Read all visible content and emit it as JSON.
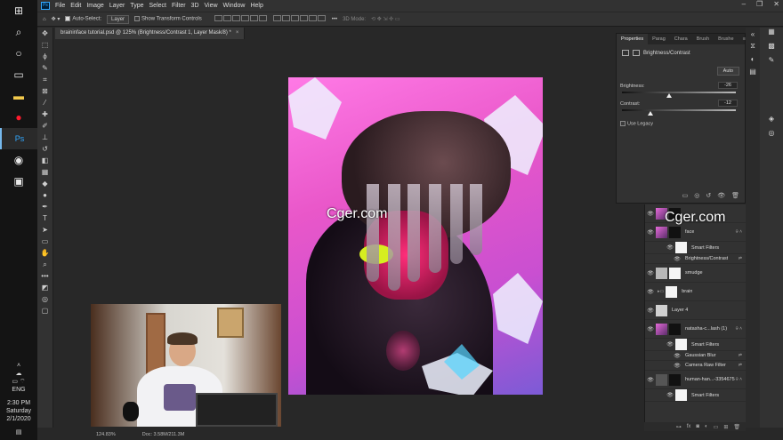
{
  "taskbar": {
    "time": "2:30 PM",
    "day": "Saturday",
    "date": "2/1/2020",
    "lang": "ENG"
  },
  "menu": {
    "items": [
      "File",
      "Edit",
      "Image",
      "Layer",
      "Type",
      "Select",
      "Filter",
      "3D",
      "View",
      "Window",
      "Help"
    ]
  },
  "options": {
    "auto_select_label": "Auto-Select:",
    "auto_select_value": "Layer",
    "show_transform_label": "Show Transform Controls",
    "mode_3d": "3D Mode:"
  },
  "document": {
    "tab_title": "braininface tutorial.psd @ 125% (Brightness/Contrast 1, Layer Mask/8) *",
    "zoom": "124.83%",
    "doc_size": "Doc: 3.58M/211.3M"
  },
  "properties": {
    "tabs": [
      "Properties",
      "Parag",
      "Chara",
      "Brush",
      "Brushe"
    ],
    "adjustment_name": "Brightness/Contrast",
    "auto_label": "Auto",
    "brightness_label": "Brightness:",
    "brightness_value": "-26",
    "brightness_level": -26,
    "contrast_label": "Contrast:",
    "contrast_value": "-12",
    "contrast_level": -12,
    "use_legacy_label": "Use Legacy"
  },
  "layers": {
    "face": "face",
    "smart_filters": "Smart Filters",
    "brightness_contrast": "Brightness/Contrast",
    "smudge": "smudge",
    "brain": "brain",
    "layer4": "Layer 4",
    "natasha": "natasha-c...lash (1)",
    "gaussian": "Gaussian Blur",
    "camera_raw": "Camera Raw Filter",
    "human": "human-han...-3354675",
    "smart_filters_2": "Smart Filters"
  },
  "watermarks": [
    "Cger.com",
    "Cger.com"
  ]
}
